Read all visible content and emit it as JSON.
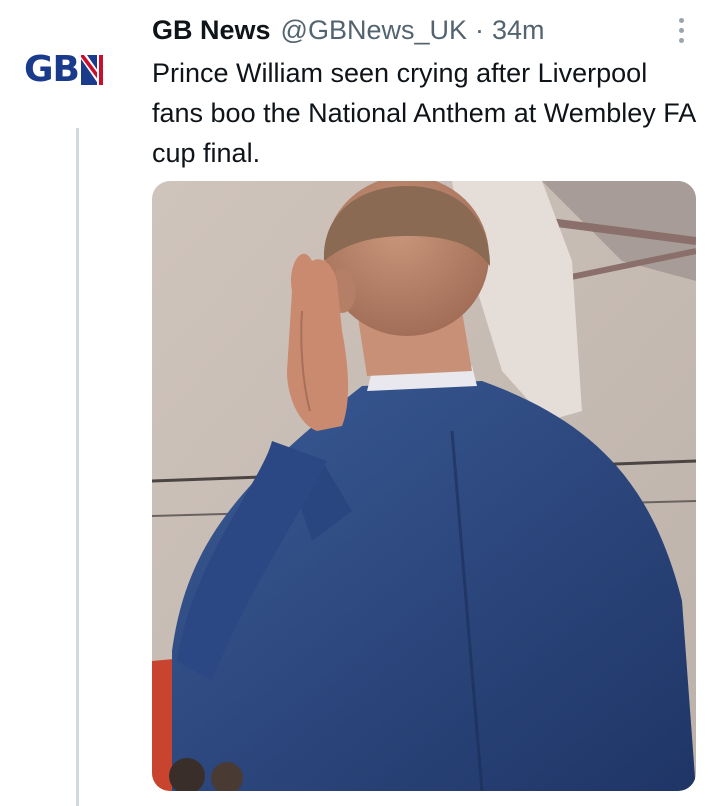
{
  "tweet": {
    "author_name": "GB News",
    "author_handle": "@GBNews_UK",
    "separator": "·",
    "timestamp": "34m",
    "text": "Prince William seen crying after Liverpool fans boo the National Anthem at Wembley FA cup final.",
    "avatar_text": "GB",
    "more_icon": "more-vertical-icon",
    "media_icon": "photo"
  },
  "colors": {
    "brand": "#1a3a8c",
    "accent_red": "#c8102e",
    "text_primary": "#0f1419",
    "text_secondary": "#536471",
    "thread_line": "#cfd9de"
  }
}
